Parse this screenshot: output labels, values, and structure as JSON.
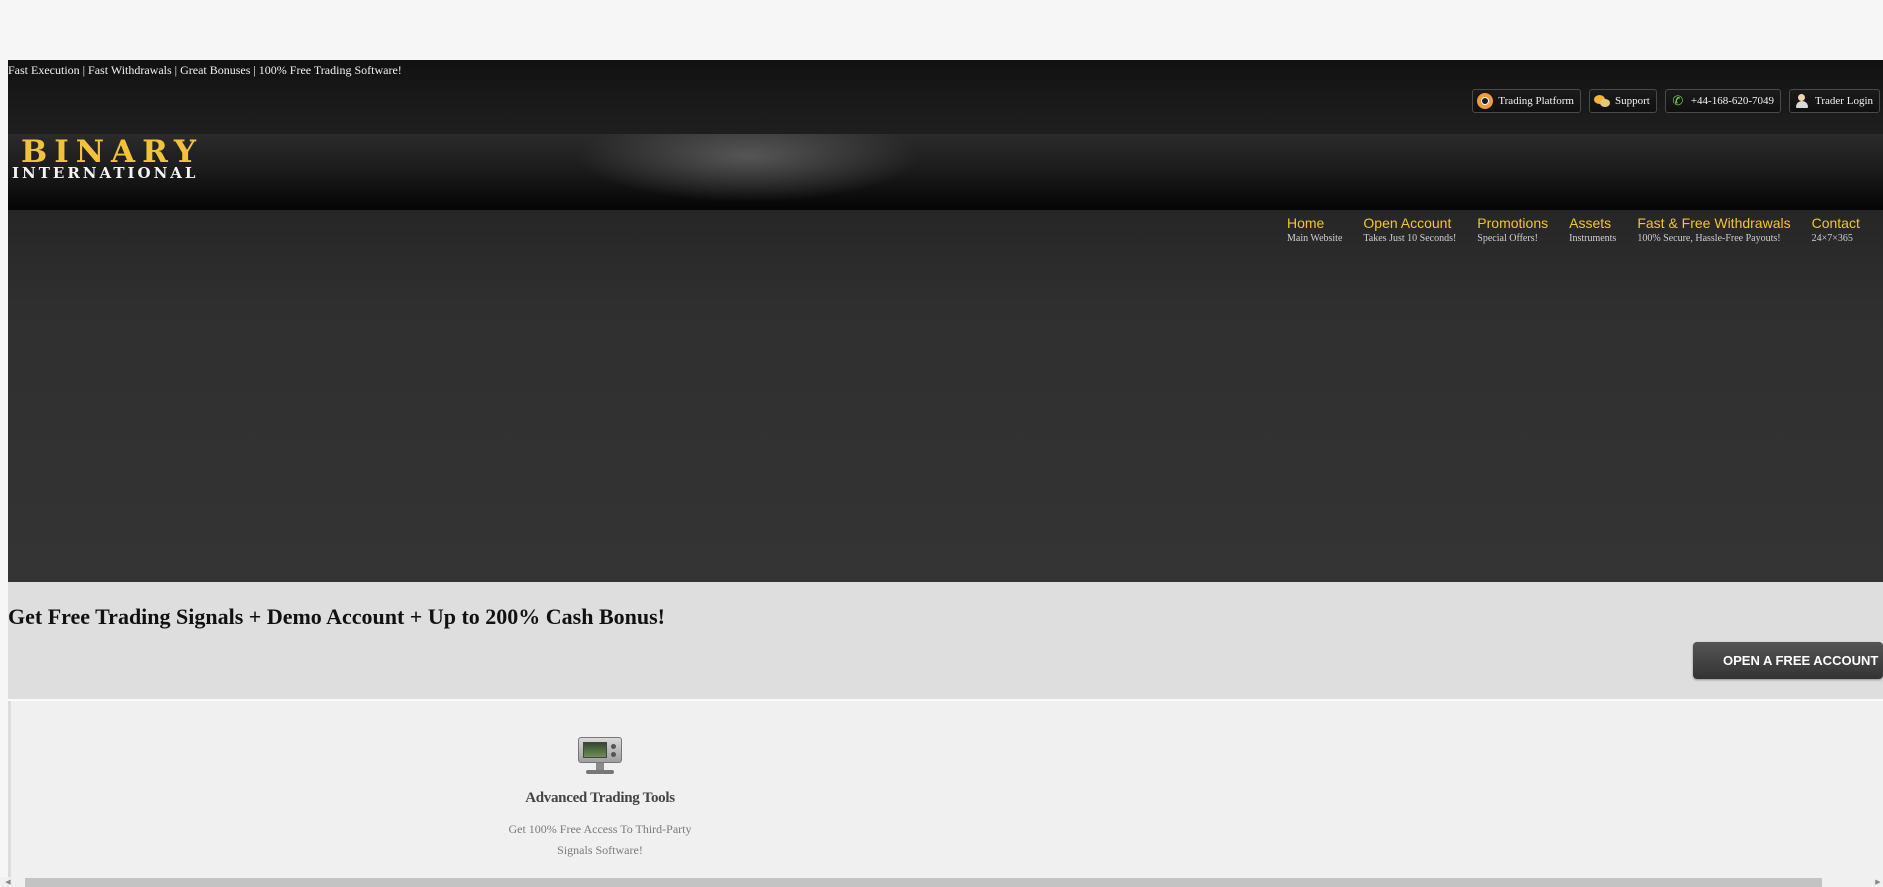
{
  "topbar": {
    "tagline": "Fast Execution | Fast Withdrawals | Great Bonuses | 100% Free Trading Software!",
    "buttons": [
      {
        "label": "Trading Platform",
        "icon": "lifebuoy-icon"
      },
      {
        "label": "Support",
        "icon": "chat-bubbles-icon"
      },
      {
        "label": "+44-168-620-7049",
        "icon": "phone-icon"
      },
      {
        "label": "Trader Login",
        "icon": "user-icon"
      }
    ]
  },
  "logo": {
    "top": "BINARY",
    "bottom": "INTERNATIONAL"
  },
  "nav": [
    {
      "title": "Home",
      "subtitle": "Main Website"
    },
    {
      "title": "Open Account",
      "subtitle": "Takes Just 10 Seconds!"
    },
    {
      "title": "Promotions",
      "subtitle": "Special Offers!"
    },
    {
      "title": "Assets",
      "subtitle": "Instruments"
    },
    {
      "title": "Fast & Free Withdrawals",
      "subtitle": "100% Secure, Hassle-Free Payouts!"
    },
    {
      "title": "Contact",
      "subtitle": "24×7×365"
    }
  ],
  "cta": {
    "title": "Get Free Trading Signals + Demo Account + Up to 200% Cash Bonus!",
    "button": "OPEN A FREE ACCOUNT"
  },
  "features": [
    {
      "icon": "computer-monitor-icon",
      "title": "Advanced Trading Tools",
      "description_line1": "Get 100% Free Access To Third-Party",
      "description_line2": "Signals Software!"
    }
  ],
  "colors": {
    "accent_gold": "#f3c62b",
    "header_dark": "#1a1a1a",
    "hero_dark": "#333333",
    "cta_band": "#dedede"
  }
}
